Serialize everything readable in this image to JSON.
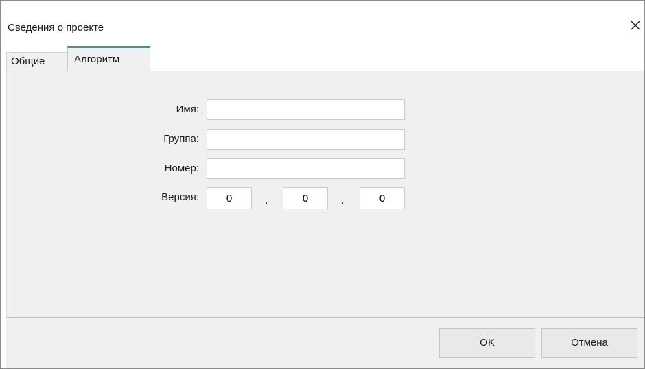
{
  "window": {
    "title": "Сведения о проекте",
    "close_icon": "close-icon"
  },
  "tabs": [
    {
      "label": "Общие",
      "active": false
    },
    {
      "label": "Алгоритм",
      "active": true
    }
  ],
  "form": {
    "name_label": "Имя:",
    "name_value": "",
    "group_label": "Группа:",
    "group_value": "",
    "number_label": "Номер:",
    "number_value": "",
    "version_label": "Версия:",
    "version_major": "0",
    "version_minor": "0",
    "version_patch": "0",
    "version_separator": "."
  },
  "footer": {
    "ok_label": "OK",
    "cancel_label": "Отмена"
  },
  "colors": {
    "active_tab_accent": "#2a9d9d",
    "panel_background": "#f0f0f0"
  }
}
